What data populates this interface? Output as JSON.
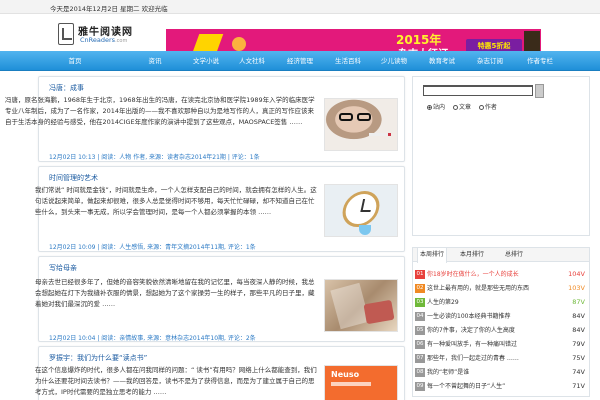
{
  "topbar": {
    "text": "今天是2014年12月2日 星期二 欢迎光临"
  },
  "header": {
    "logo_cn": "雅牛阅读网",
    "logo_en": "CnReaders",
    "logo_en_suffix": ".com",
    "banner": {
      "year_text": "2015年",
      "headline": "杂志大征订",
      "badge": "特惠5折起"
    }
  },
  "nav": {
    "items": [
      "首页",
      "资讯",
      "文学小说",
      "人文社科",
      "经济管理",
      "生活百科",
      "少儿读物",
      "教育考试",
      "杂志订阅",
      "作者专栏"
    ]
  },
  "articles": [
    {
      "title": "冯唐：成事",
      "body": "冯唐，原名张海鹏，1968年生于北京，1968年出生的冯唐，在读完北京协和医学院1989年入学的临床医学专业八年制后，成为了一名作家，2014年出版的——我不喜欢那种自以为是地写作的人，真正的写作应该来自于生活本身的经验与感受，他在2014CIGE年度作家的演讲中提到了这些观点，MAOSPACE签售 ……",
      "meta": "12月02日 10:13 | 阅读：人物 作者, 来源：读者杂志2014年21期 | 评论：1条"
    },
    {
      "title": "时间管理的艺术",
      "body": "我们常说“ 时间就是金钱”，时间就是生命，一个人怎样支配自己的时间，就会拥有怎样的人生。这句话说起来简单，做起来却很难，很多人总是觉得时间不够用，每天忙忙碌碌，却不知道自己在忙些什么，到头来一事无成，所以学会管理时间，是每一个人都必须掌握的本领 ……",
      "meta": "12月02日 10:09 | 阅读：人生感悟, 来源：青年文摘2014年11期, 评论：1条"
    },
    {
      "title": "写给母亲",
      "body": "母亲去世已经很多年了，但她的音容笑貌依然清晰地留在我的记忆里，每当夜深人静的时候，我总会想起她在灯下为我缝补衣服的情景，想起她为了这个家操劳一生的样子，那些平凡的日子里，藏着她对我们最深沉的爱 ……",
      "meta": "12月02日 10:04 | 阅读：亲情故事, 来源：意林杂志2014年10期, 评论：2条"
    },
    {
      "title": "罗振宇：我们为什么要“读点书”",
      "body": "在这个信息爆炸的时代，很多人都在问我同样的问题：“ 读书”有用吗？网络上什么都能查到，我们为什么还要花时间去读书？——我的回答是，读书不是为了获得信息，而是为了建立属于自己的思考方式，IP时代需要的是独立思考的能力 ……",
      "meta": ""
    }
  ],
  "search": {
    "options": [
      "站内",
      "文章",
      "作者"
    ],
    "selected": "站内"
  },
  "ranking": {
    "tabs": [
      "本周排行",
      "本月排行",
      "总排行"
    ],
    "items": [
      {
        "num": "01",
        "title": "你18岁时在做什么，一个人的成长",
        "count": "104V",
        "color": "#e8413c",
        "text_color": "#e8413c"
      },
      {
        "num": "02",
        "title": "这世上最有用的，就是那些无用的东西",
        "count": "103V",
        "color": "#f08a24",
        "text_color": "#333"
      },
      {
        "num": "03",
        "title": "人生的第29",
        "count": "87V",
        "color": "#6fb93a",
        "text_color": "#333"
      },
      {
        "num": "04",
        "title": "一生必读的100本经典书籍推荐",
        "count": "84V",
        "color": "#999999",
        "text_color": "#333"
      },
      {
        "num": "05",
        "title": "你的7件事，决定了你的人生高度",
        "count": "84V",
        "color": "#999999",
        "text_color": "#333"
      },
      {
        "num": "06",
        "title": "有一种爱叫放手，有一种痛叫错过",
        "count": "79V",
        "color": "#999999",
        "text_color": "#333"
      },
      {
        "num": "07",
        "title": "那些年，我们一起走过的青春 ……",
        "count": "75V",
        "color": "#999999",
        "text_color": "#333"
      },
      {
        "num": "08",
        "title": "我的“老师”是谁",
        "count": "74V",
        "color": "#999999",
        "text_color": "#333"
      },
      {
        "num": "09",
        "title": "每一个不曾起舞的日子“人生”",
        "count": "71V",
        "color": "#999999",
        "text_color": "#333"
      }
    ]
  }
}
